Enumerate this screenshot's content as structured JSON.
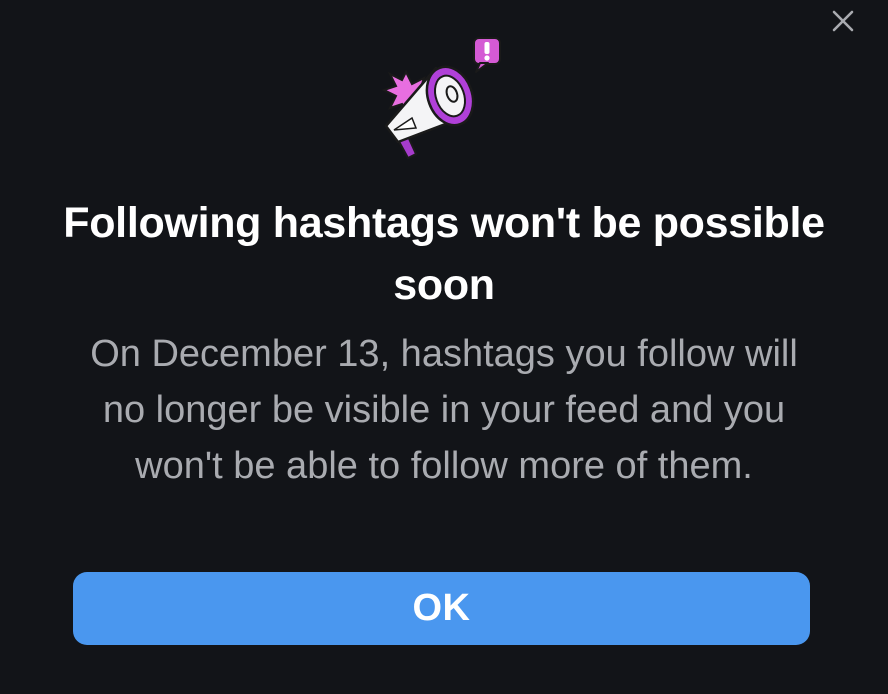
{
  "dialog": {
    "title": "Following hashtags won't be possible soon",
    "body": "On December 13, hashtags you follow will no longer be visible in your feed and you won't be able to follow more of them.",
    "ok_label": "OK"
  },
  "icons": {
    "close": "close-icon",
    "illustration": "megaphone-alert-icon"
  },
  "colors": {
    "background": "#121418",
    "button": "#4a97ef",
    "title_text": "#ffffff",
    "body_text": "#a9abb0",
    "accent": "#a63ccc"
  }
}
